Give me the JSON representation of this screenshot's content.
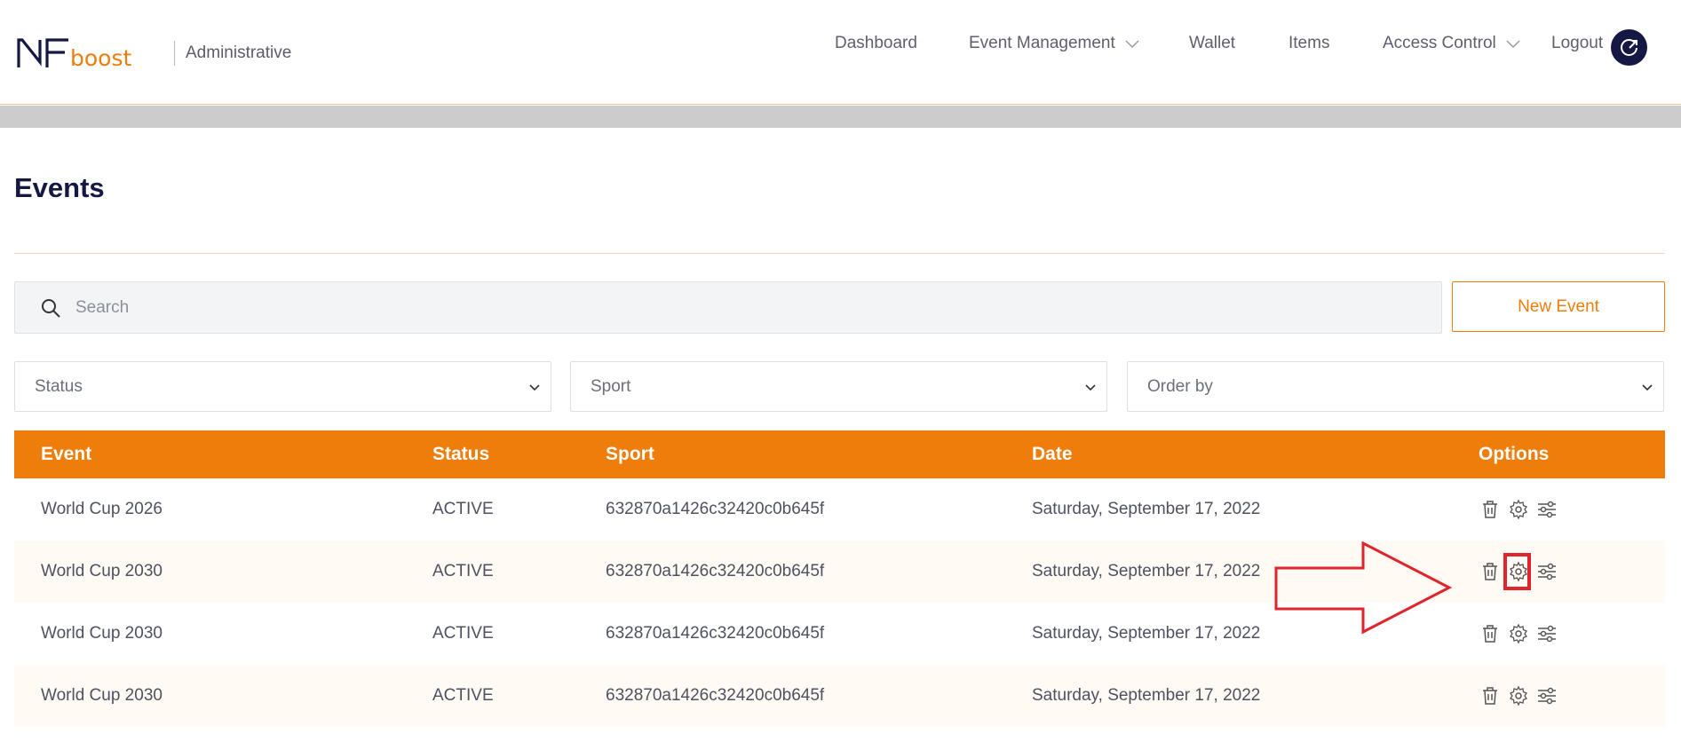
{
  "header": {
    "logo_text": "NFboost",
    "subtitle": "Administrative",
    "nav": {
      "dashboard": "Dashboard",
      "event_management": "Event Management",
      "wallet": "Wallet",
      "items": "Items",
      "access_control": "Access Control",
      "logout": "Logout"
    }
  },
  "page": {
    "title": "Events"
  },
  "toolbar": {
    "search_placeholder": "Search",
    "new_event_label": "New Event"
  },
  "filters": {
    "status": "Status",
    "sport": "Sport",
    "order_by": "Order by"
  },
  "table": {
    "columns": {
      "event": "Event",
      "status": "Status",
      "sport": "Sport",
      "date": "Date",
      "options": "Options"
    },
    "rows": [
      {
        "event": "World Cup 2026",
        "status": "ACTIVE",
        "sport": "632870a1426c32420c0b645f",
        "date": "Saturday, September 17, 2022"
      },
      {
        "event": "World Cup 2030",
        "status": "ACTIVE",
        "sport": "632870a1426c32420c0b645f",
        "date": "Saturday, September 17, 2022"
      },
      {
        "event": "World Cup 2030",
        "status": "ACTIVE",
        "sport": "632870a1426c32420c0b645f",
        "date": "Saturday, September 17, 2022"
      },
      {
        "event": "World Cup 2030",
        "status": "ACTIVE",
        "sport": "632870a1426c32420c0b645f",
        "date": "Saturday, September 17, 2022"
      }
    ]
  },
  "icons": {
    "search": "search-icon",
    "delete": "trash-icon",
    "settings": "gear-icon",
    "adjust": "sliders-icon",
    "logout": "logout-icon",
    "dropdown": "chevron-down-icon"
  },
  "colors": {
    "accent": "#ee7d0a",
    "brand_navy": "#141843",
    "annotation_red": "#e0242b"
  }
}
